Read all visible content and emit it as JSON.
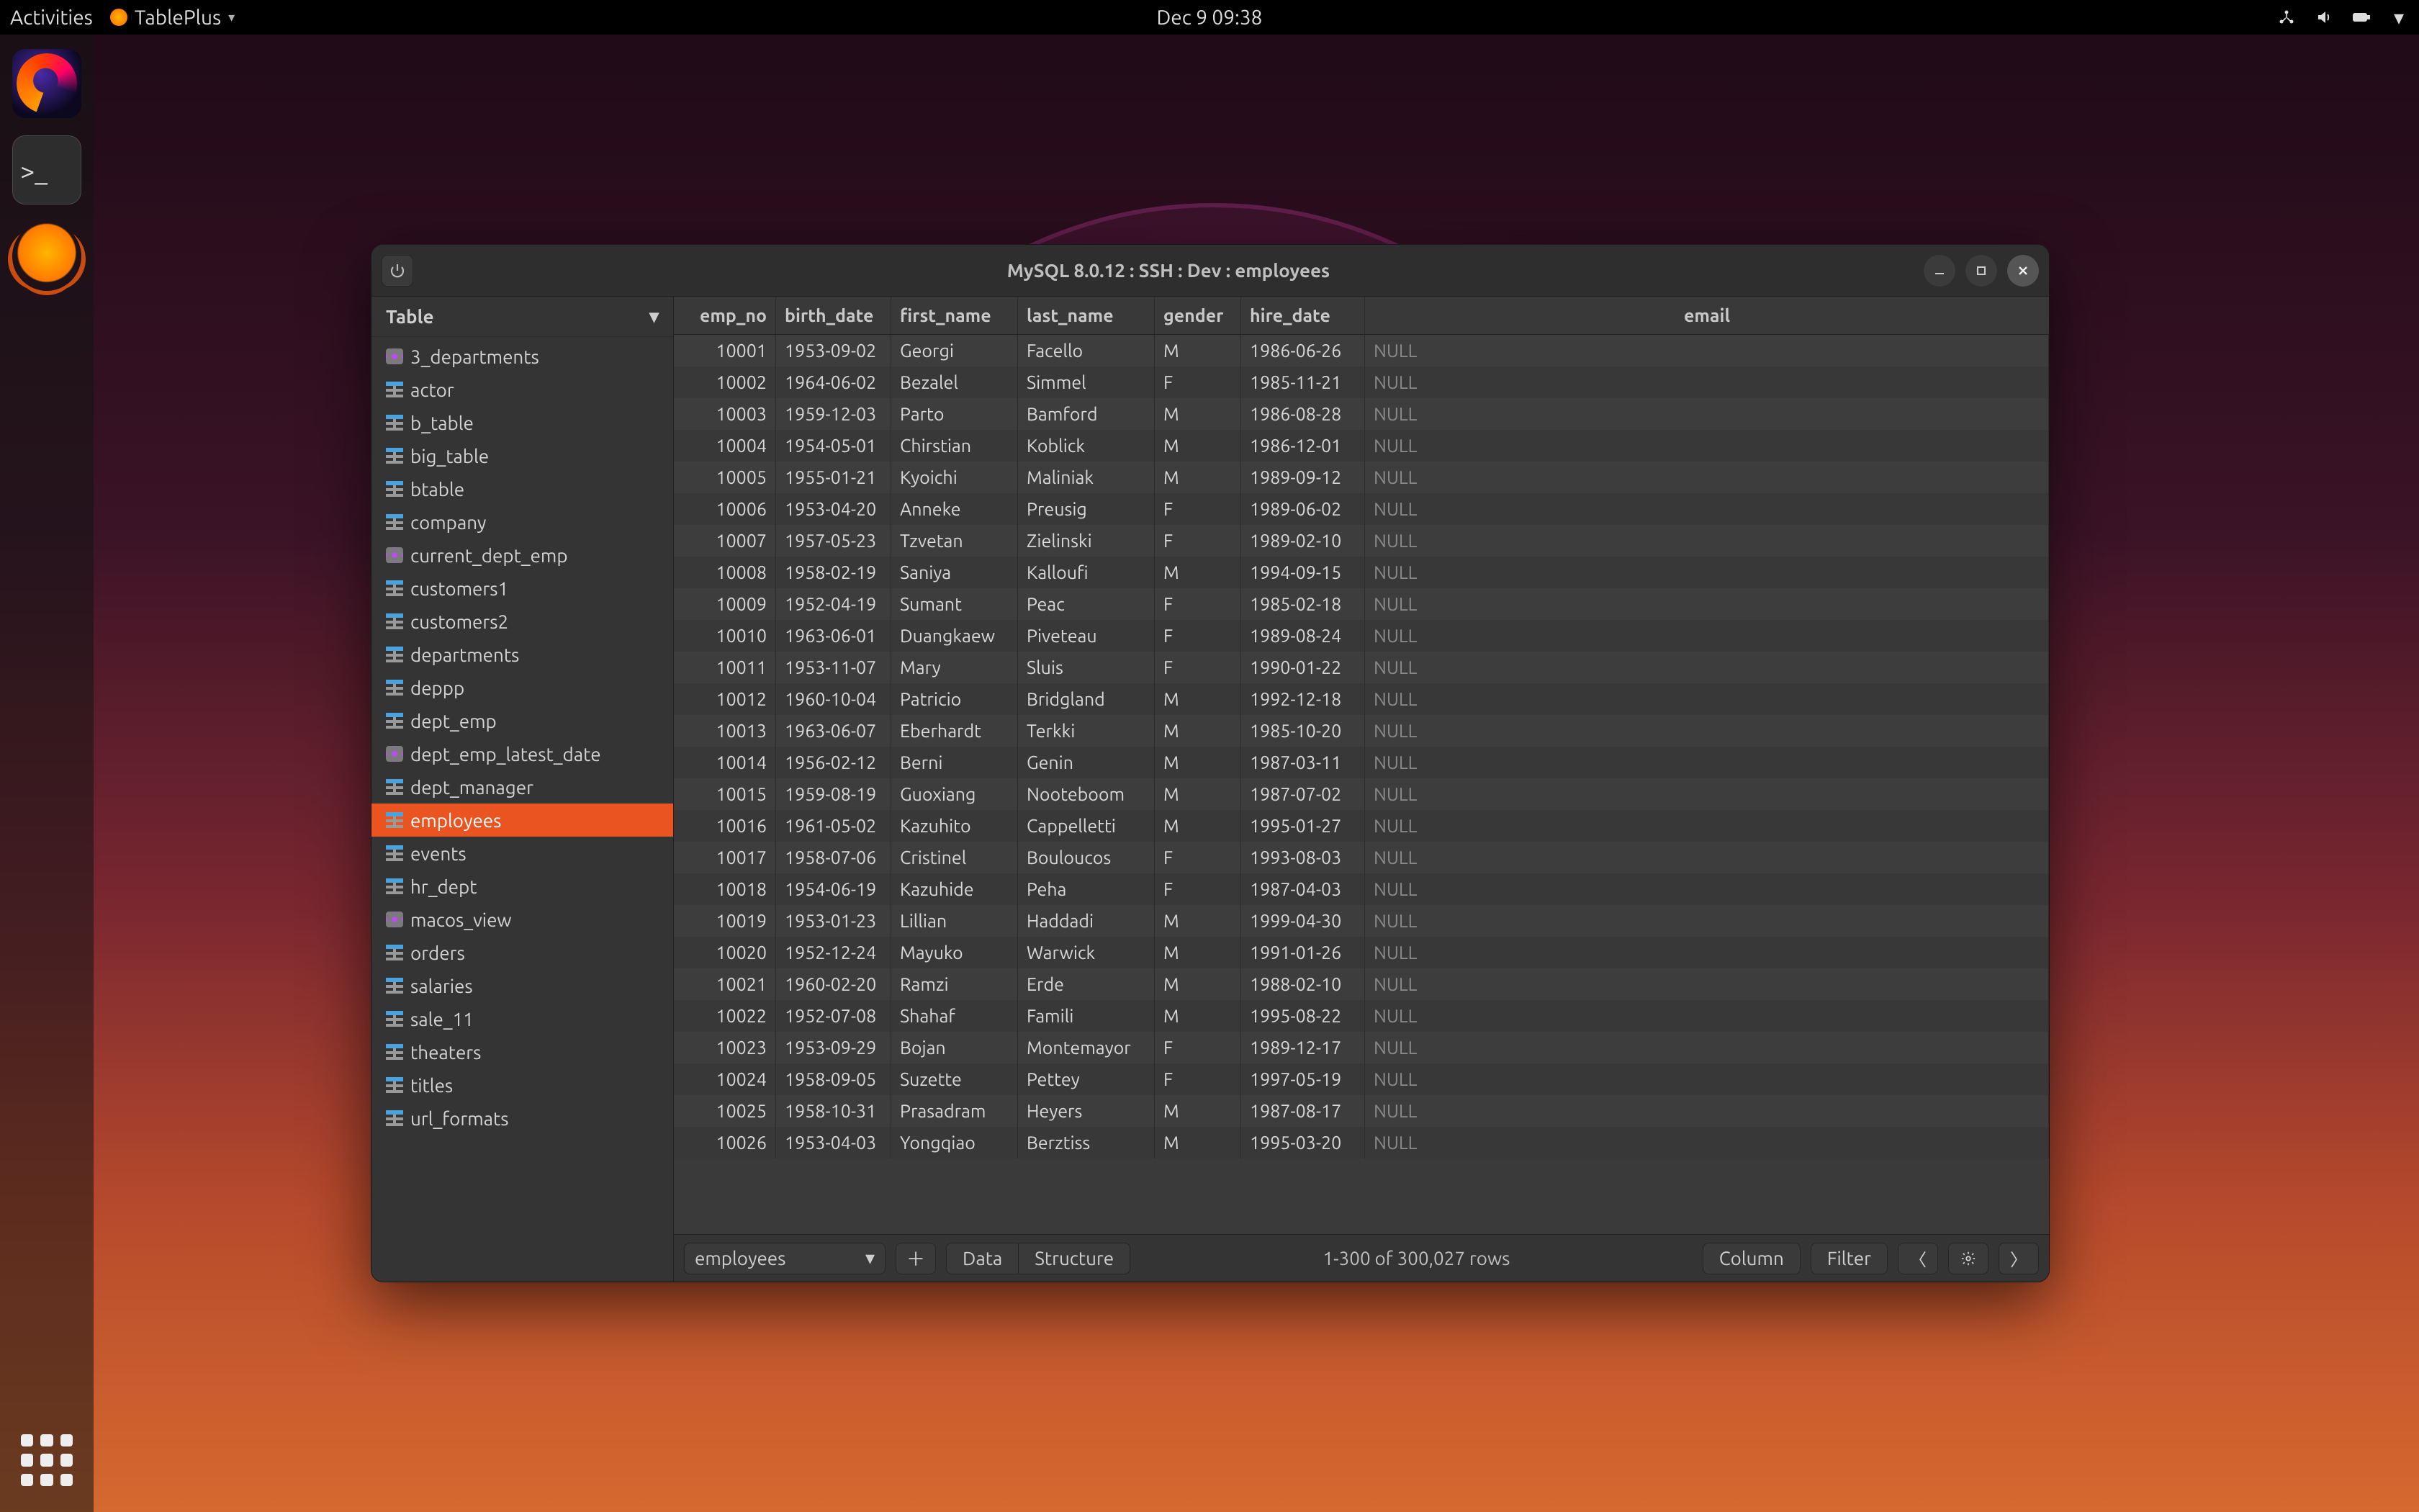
{
  "topbar": {
    "activities": "Activities",
    "app_name": "TablePlus",
    "clock": "Dec 9  09:38"
  },
  "window": {
    "title": "MySQL 8.0.12  :  SSH  :  Dev   :  employees"
  },
  "sidebar": {
    "header": "Table",
    "items": [
      {
        "label": "3_departments",
        "kind": "view"
      },
      {
        "label": "actor",
        "kind": "table"
      },
      {
        "label": "b_table",
        "kind": "table"
      },
      {
        "label": "big_table",
        "kind": "table"
      },
      {
        "label": "btable",
        "kind": "table"
      },
      {
        "label": "company",
        "kind": "table"
      },
      {
        "label": "current_dept_emp",
        "kind": "view"
      },
      {
        "label": "customers1",
        "kind": "table"
      },
      {
        "label": "customers2",
        "kind": "table"
      },
      {
        "label": "departments",
        "kind": "table"
      },
      {
        "label": "deppp",
        "kind": "table"
      },
      {
        "label": "dept_emp",
        "kind": "table"
      },
      {
        "label": "dept_emp_latest_date",
        "kind": "view"
      },
      {
        "label": "dept_manager",
        "kind": "table"
      },
      {
        "label": "employees",
        "kind": "table",
        "selected": true
      },
      {
        "label": "events",
        "kind": "table"
      },
      {
        "label": "hr_dept",
        "kind": "table"
      },
      {
        "label": "macos_view",
        "kind": "view"
      },
      {
        "label": "orders",
        "kind": "table"
      },
      {
        "label": "salaries",
        "kind": "table"
      },
      {
        "label": "sale_11",
        "kind": "table"
      },
      {
        "label": "theaters",
        "kind": "table"
      },
      {
        "label": "titles",
        "kind": "table"
      },
      {
        "label": "url_formats",
        "kind": "table"
      }
    ]
  },
  "grid": {
    "columns": [
      "emp_no",
      "birth_date",
      "first_name",
      "last_name",
      "gender",
      "hire_date",
      "email"
    ],
    "rows": [
      [
        "10001",
        "1953-09-02",
        "Georgi",
        "Facello",
        "M",
        "1986-06-26",
        "NULL"
      ],
      [
        "10002",
        "1964-06-02",
        "Bezalel",
        "Simmel",
        "F",
        "1985-11-21",
        "NULL"
      ],
      [
        "10003",
        "1959-12-03",
        "Parto",
        "Bamford",
        "M",
        "1986-08-28",
        "NULL"
      ],
      [
        "10004",
        "1954-05-01",
        "Chirstian",
        "Koblick",
        "M",
        "1986-12-01",
        "NULL"
      ],
      [
        "10005",
        "1955-01-21",
        "Kyoichi",
        "Maliniak",
        "M",
        "1989-09-12",
        "NULL"
      ],
      [
        "10006",
        "1953-04-20",
        "Anneke",
        "Preusig",
        "F",
        "1989-06-02",
        "NULL"
      ],
      [
        "10007",
        "1957-05-23",
        "Tzvetan",
        "Zielinski",
        "F",
        "1989-02-10",
        "NULL"
      ],
      [
        "10008",
        "1958-02-19",
        "Saniya",
        "Kalloufi",
        "M",
        "1994-09-15",
        "NULL"
      ],
      [
        "10009",
        "1952-04-19",
        "Sumant",
        "Peac",
        "F",
        "1985-02-18",
        "NULL"
      ],
      [
        "10010",
        "1963-06-01",
        "Duangkaew",
        "Piveteau",
        "F",
        "1989-08-24",
        "NULL"
      ],
      [
        "10011",
        "1953-11-07",
        "Mary",
        "Sluis",
        "F",
        "1990-01-22",
        "NULL"
      ],
      [
        "10012",
        "1960-10-04",
        "Patricio",
        "Bridgland",
        "M",
        "1992-12-18",
        "NULL"
      ],
      [
        "10013",
        "1963-06-07",
        "Eberhardt",
        "Terkki",
        "M",
        "1985-10-20",
        "NULL"
      ],
      [
        "10014",
        "1956-02-12",
        "Berni",
        "Genin",
        "M",
        "1987-03-11",
        "NULL"
      ],
      [
        "10015",
        "1959-08-19",
        "Guoxiang",
        "Nooteboom",
        "M",
        "1987-07-02",
        "NULL"
      ],
      [
        "10016",
        "1961-05-02",
        "Kazuhito",
        "Cappelletti",
        "M",
        "1995-01-27",
        "NULL"
      ],
      [
        "10017",
        "1958-07-06",
        "Cristinel",
        "Bouloucos",
        "F",
        "1993-08-03",
        "NULL"
      ],
      [
        "10018",
        "1954-06-19",
        "Kazuhide",
        "Peha",
        "F",
        "1987-04-03",
        "NULL"
      ],
      [
        "10019",
        "1953-01-23",
        "Lillian",
        "Haddadi",
        "M",
        "1999-04-30",
        "NULL"
      ],
      [
        "10020",
        "1952-12-24",
        "Mayuko",
        "Warwick",
        "M",
        "1991-01-26",
        "NULL"
      ],
      [
        "10021",
        "1960-02-20",
        "Ramzi",
        "Erde",
        "M",
        "1988-02-10",
        "NULL"
      ],
      [
        "10022",
        "1952-07-08",
        "Shahaf",
        "Famili",
        "M",
        "1995-08-22",
        "NULL"
      ],
      [
        "10023",
        "1953-09-29",
        "Bojan",
        "Montemayor",
        "F",
        "1989-12-17",
        "NULL"
      ],
      [
        "10024",
        "1958-09-05",
        "Suzette",
        "Pettey",
        "F",
        "1997-05-19",
        "NULL"
      ],
      [
        "10025",
        "1958-10-31",
        "Prasadram",
        "Heyers",
        "M",
        "1987-08-17",
        "NULL"
      ],
      [
        "10026",
        "1953-04-03",
        "Yongqiao",
        "Berztiss",
        "M",
        "1995-03-20",
        "NULL"
      ]
    ]
  },
  "bottombar": {
    "selector": "employees",
    "tab_data": "Data",
    "tab_structure": "Structure",
    "status": "1-300 of 300,027 rows",
    "column_btn": "Column",
    "filter_btn": "Filter"
  }
}
